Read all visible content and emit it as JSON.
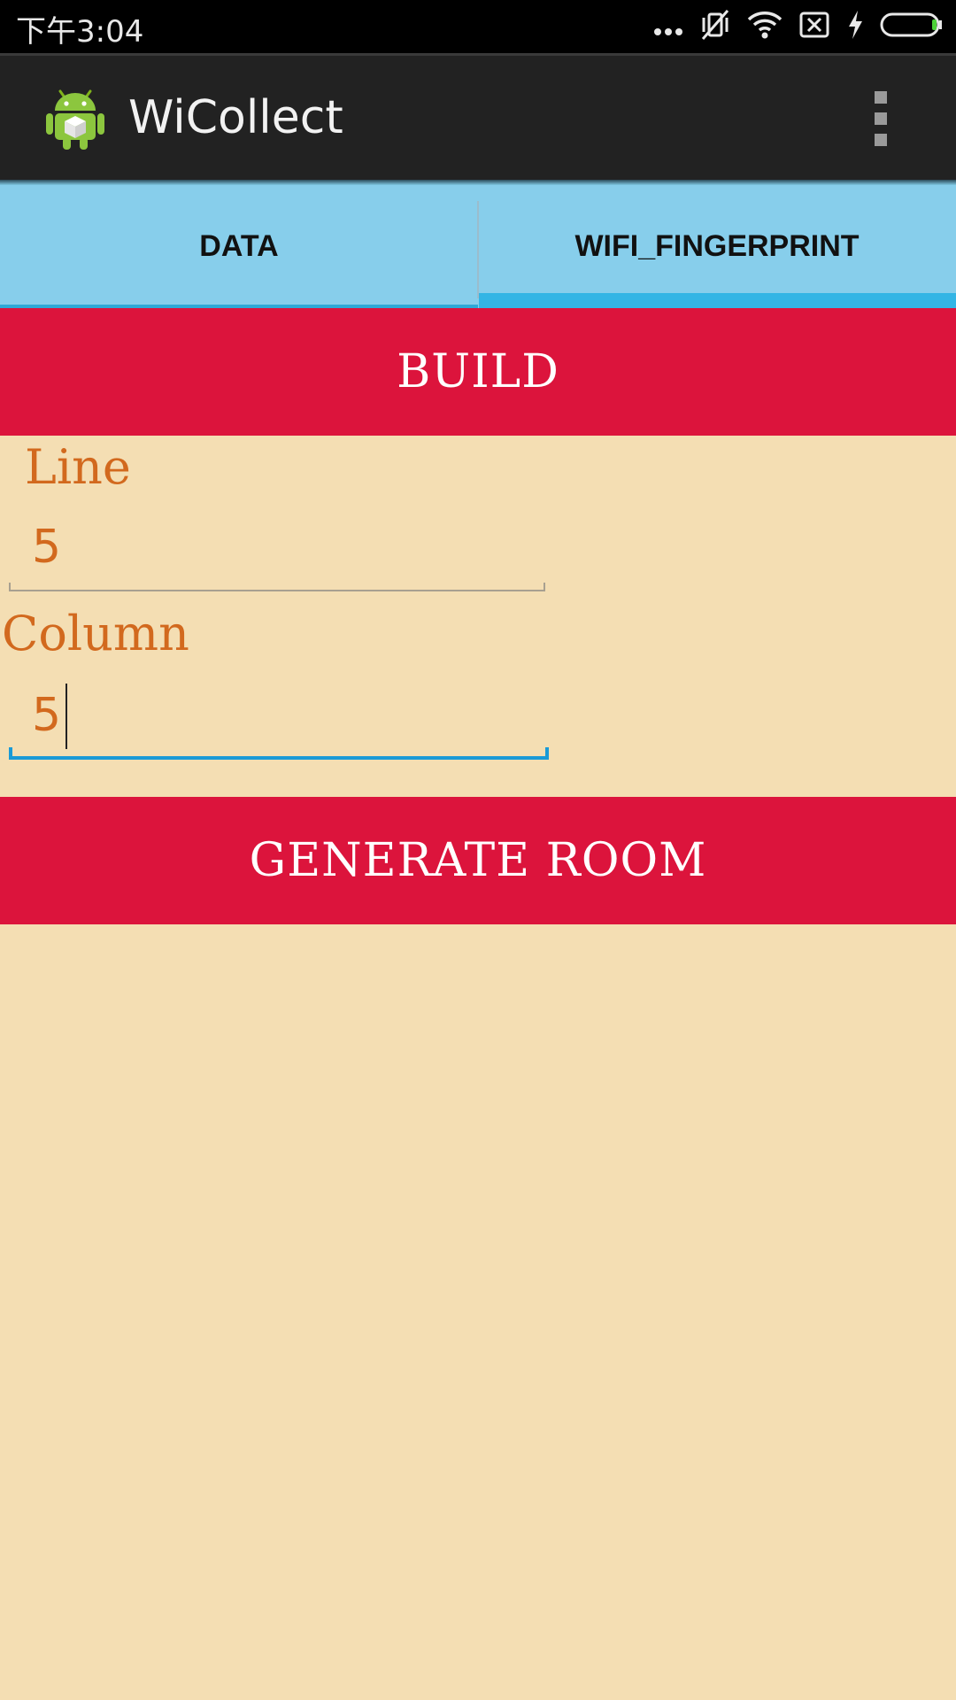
{
  "status_bar": {
    "time": "下午3:04",
    "icons": [
      "more-dots-icon",
      "vibrate-off-icon",
      "wifi-icon",
      "no-sim-icon",
      "charging-icon",
      "battery-icon"
    ]
  },
  "app_bar": {
    "title": "WiCollect",
    "icon": "android-app-icon",
    "menu_icon": "overflow-menu-icon"
  },
  "tabs": [
    {
      "label": "DATA",
      "selected": false
    },
    {
      "label": "WIFI_FINGERPRINT",
      "selected": true
    }
  ],
  "build_button": {
    "label": "BUILD"
  },
  "fields": {
    "line": {
      "label": "Line",
      "value": "5"
    },
    "column": {
      "label": "Column",
      "value": "5",
      "focused": true
    }
  },
  "generate_button": {
    "label": "GENERATE ROOM"
  },
  "colors": {
    "background": "#f4deb3",
    "button": "#dc143c",
    "label": "#d2691e",
    "tab_bar": "#87ceeb",
    "tab_indicator": "#33b5e5",
    "action_bar": "#222222"
  }
}
